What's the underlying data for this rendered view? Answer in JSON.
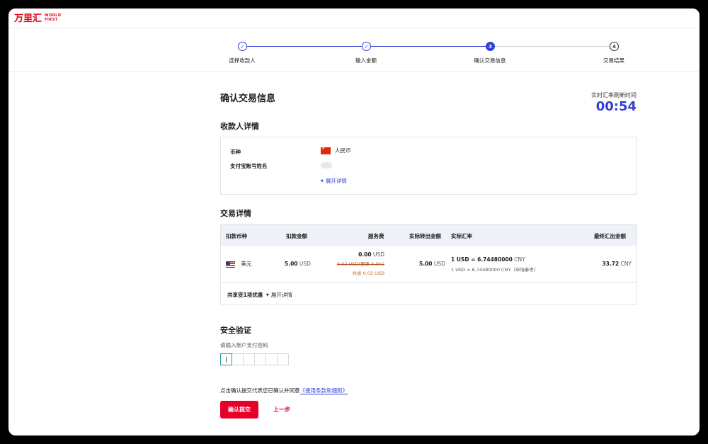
{
  "header": {
    "logo_cn": "万里汇",
    "logo_en_line1": "WORLD",
    "logo_en_line2": "FIRST"
  },
  "stepper": {
    "steps": [
      {
        "label": "选择收款人",
        "state": "done",
        "marker": "✓"
      },
      {
        "label": "输入金额",
        "state": "done",
        "marker": "✓"
      },
      {
        "label": "确认交易信息",
        "state": "active",
        "marker": "3"
      },
      {
        "label": "交易结果",
        "state": "todo",
        "marker": "4"
      }
    ]
  },
  "page": {
    "title": "确认交易信息",
    "timer_label": "实时汇率刷新时间",
    "timer_value": "00:54"
  },
  "payee": {
    "section_title": "收款人详情",
    "currency_label": "币种",
    "currency_value": "人民币",
    "account_label": "支付宝账号姓名",
    "expand_link": "展开详情"
  },
  "transaction": {
    "section_title": "交易详情",
    "headers": [
      "扣款币种",
      "扣款金额",
      "服务费",
      "实际转出金额",
      "实际汇率",
      "最终汇出金额"
    ],
    "row": {
      "currency": "美元",
      "debit_amount": "5.00",
      "debit_unit": "USD",
      "fee_amount": "0.00",
      "fee_unit": "USD",
      "fee_original": "0.02 USD(费率 0.3%)",
      "fee_discount": "共省 0.02 USD",
      "out_amount": "5.00",
      "out_unit": "USD",
      "rate_main_prefix": "1 USD = ",
      "rate_main_value": "6.74480000",
      "rate_main_unit": " CNY",
      "rate_ref": "1 USD = 6.74480000 CNY（市场参考）",
      "final_amount": "33.72",
      "final_unit": "CNY"
    },
    "footer_text": "共享受1项优惠",
    "footer_link": "展开详情"
  },
  "security": {
    "section_title": "安全验证",
    "hint": "请输入账户支付密码"
  },
  "agreement": {
    "text": "点击确认提交代表您已确认并同意",
    "link": "《使用条款和细则》"
  },
  "actions": {
    "submit_label": "确认提交",
    "prev_label": "上一步"
  },
  "colors": {
    "brand_red": "#e60012",
    "accent_blue": "#2f3fd8"
  }
}
